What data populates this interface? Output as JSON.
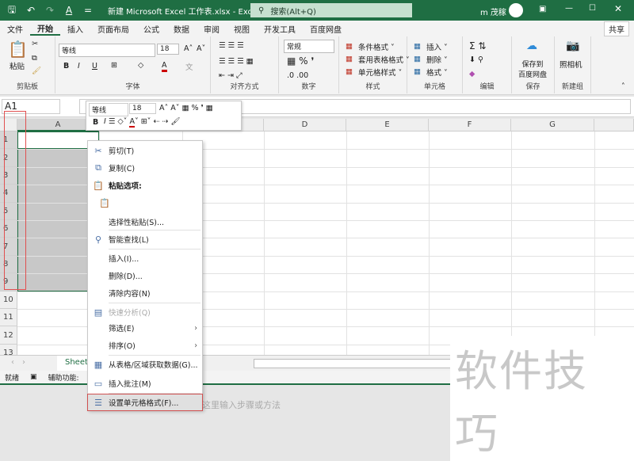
{
  "title_bar": {
    "title": "新建 Microsoft Excel 工作表.xlsx  -  Excel",
    "search_placeholder": "搜索(Alt+Q)",
    "user": "m 茂稼",
    "brand_color": "#1f6e43"
  },
  "tabs": [
    "文件",
    "开始",
    "插入",
    "页面布局",
    "公式",
    "数据",
    "审阅",
    "视图",
    "开发工具",
    "百度网盘"
  ],
  "share": "共享",
  "ribbon": {
    "clipboard": {
      "label": "剪贴板",
      "paste": "粘贴"
    },
    "font": {
      "label": "字体",
      "name": "等线",
      "size": "18",
      "bold": "B",
      "italic": "I",
      "underline": "U"
    },
    "alignment": {
      "label": "对齐方式"
    },
    "number": {
      "label": "数字",
      "format": "常规"
    },
    "styles": {
      "label": "样式",
      "items": [
        "条件格式 ˅",
        "套用表格格式 ˅",
        "单元格样式 ˅"
      ]
    },
    "cells": {
      "label": "单元格",
      "items": [
        "插入 ˅",
        "删除 ˅",
        "格式 ˅"
      ]
    },
    "editing": {
      "label": "编辑"
    },
    "save": {
      "label": "保存",
      "button": "保存到\n百度网盘"
    },
    "newgroup": {
      "label": "新建组",
      "button": "照相机"
    }
  },
  "name_box": "A1",
  "columns": [
    "A",
    "B",
    "C",
    "D",
    "E",
    "F",
    "G"
  ],
  "rows": [
    "1",
    "2",
    "3",
    "4",
    "5",
    "6",
    "7",
    "8",
    "9",
    "10",
    "11",
    "12",
    "13"
  ],
  "mini_toolbar": {
    "font": "等线",
    "size": "18"
  },
  "context_menu": [
    {
      "icon": "scissors-icon",
      "glyph": "✂",
      "label": "剪切(T)"
    },
    {
      "icon": "copy-icon",
      "glyph": "⧉",
      "label": "复制(C)"
    },
    {
      "icon": "paste-icon",
      "glyph": "📋",
      "label": "粘贴选项:"
    },
    {
      "icon": "paste-text-icon",
      "glyph": "📋",
      "label": ""
    },
    {
      "icon": "",
      "glyph": "",
      "label": "选择性粘贴(S)..."
    },
    {
      "icon": "smart-lookup-icon",
      "glyph": "⚲",
      "label": "智能查找(L)"
    },
    {
      "icon": "",
      "glyph": "",
      "label": "插入(I)..."
    },
    {
      "icon": "",
      "glyph": "",
      "label": "删除(D)..."
    },
    {
      "icon": "",
      "glyph": "",
      "label": "清除内容(N)"
    },
    {
      "icon": "quick-analysis-icon",
      "glyph": "▤",
      "label": "快速分析(Q)"
    },
    {
      "icon": "",
      "glyph": "",
      "label": "筛选(E)"
    },
    {
      "icon": "",
      "glyph": "",
      "label": "排序(O)"
    },
    {
      "icon": "table-icon",
      "glyph": "▦",
      "label": "从表格/区域获取数据(G)..."
    },
    {
      "icon": "comment-icon",
      "glyph": "▭",
      "label": "插入批注(M)"
    },
    {
      "icon": "format-cells-icon",
      "glyph": "☰",
      "label": "设置单元格格式(F)..."
    }
  ],
  "sheet_tab": "Sheet1",
  "status": {
    "ready": "就绪",
    "accessibility": "辅助功能:"
  },
  "below_text": "这里输入步骤或方法",
  "watermark": "软件技巧"
}
